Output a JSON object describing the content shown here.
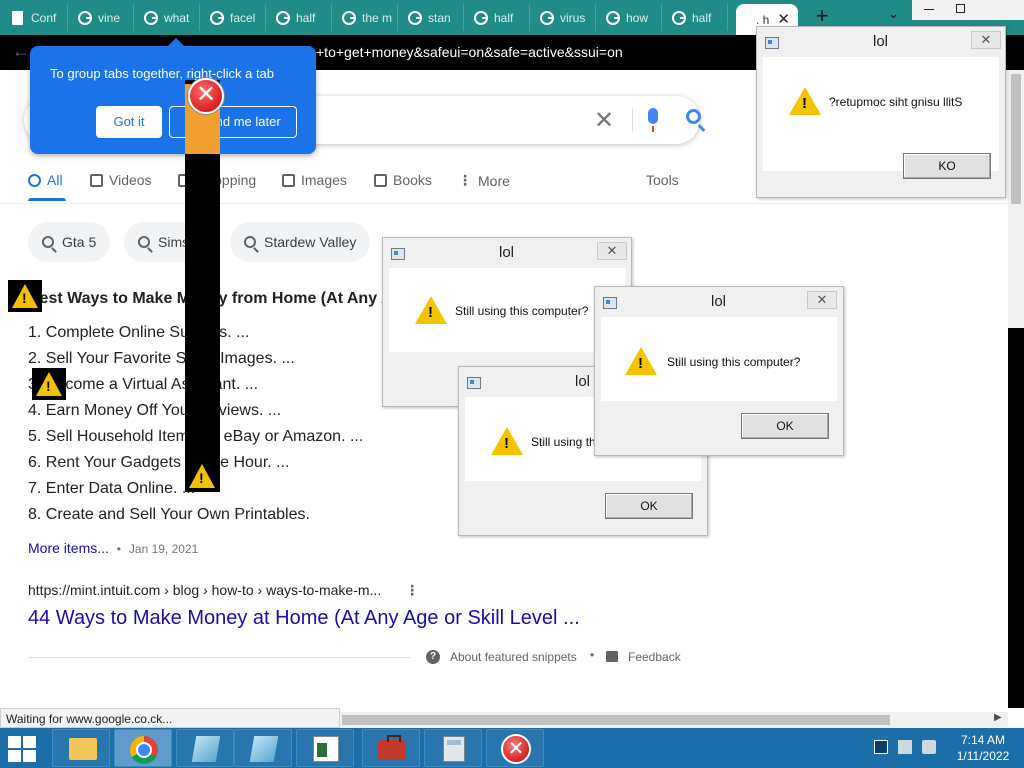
{
  "browser": {
    "tabs": [
      {
        "label": "Conf",
        "icon": "doc-icon"
      },
      {
        "label": "vine",
        "icon": "google-icon"
      },
      {
        "label": "what",
        "icon": "google-icon"
      },
      {
        "label": "facel",
        "icon": "google-icon"
      },
      {
        "label": "half",
        "icon": "google-icon"
      },
      {
        "label": "the m",
        "icon": "google-icon"
      },
      {
        "label": "stan",
        "icon": "google-icon"
      },
      {
        "label": "half",
        "icon": "google-icon"
      },
      {
        "label": "virus",
        "icon": "google-icon"
      },
      {
        "label": "how",
        "icon": "google-icon"
      },
      {
        "label": "half",
        "icon": "google-icon"
      }
    ],
    "active_tab": {
      "label": ". h",
      "close": "✕"
    },
    "new_tab": "+",
    "tab_search": "⌄",
    "url_visible": "+to+get+money&safeui=on&safe=active&ssui=on",
    "back": "←",
    "status_text": "Waiting for www.google.co.ck..."
  },
  "promo": {
    "text": "To group tabs together, right-click a tab",
    "got_it": "Got it",
    "remind_later": "Remind me later"
  },
  "search": {
    "clear": "✕"
  },
  "result_tabs": [
    {
      "label": "All",
      "icon": "search-icon",
      "active": true
    },
    {
      "label": "Videos",
      "icon": "video-icon"
    },
    {
      "label": "Shopping",
      "icon": "tag-icon"
    },
    {
      "label": "Images",
      "icon": "image-icon"
    },
    {
      "label": "Books",
      "icon": "book-icon"
    },
    {
      "label": "More",
      "icon": "more-vert-icon"
    }
  ],
  "tools": "Tools",
  "chips": [
    "Gta 5",
    "Sims 4",
    "Stardew Valley"
  ],
  "snippet": {
    "title": "Best Ways to Make Money from Home (At Any Age",
    "items": [
      "1. Complete Online Surveys. ...",
      "2. Sell Your Favorite Stock Images. ...",
      "3. Become a Virtual Assistant. ...",
      "4. Earn Money Off Your Reviews. ...",
      "5. Sell Household Items on eBay or Amazon. ...",
      "6. Rent Your Gadgets by the Hour. ...",
      "7. Enter Data Online. ...",
      "8. Create and Sell Your Own Printables."
    ],
    "more_items": "More items...",
    "date_sep": "•",
    "date": "Jan 19, 2021"
  },
  "result": {
    "cite": "https://mint.intuit.com › blog › how-to › ways-to-make-m...",
    "menu": "⋮",
    "title": "44 Ways to Make Money at Home (At Any Age or Skill Level ..."
  },
  "about": {
    "q": "?",
    "about_text": "About featured snippets",
    "bullet": "•",
    "feedback": "Feedback"
  },
  "dialogs": [
    {
      "title": "lol",
      "message": "?retupmoc siht gnisu llitS",
      "button": "KO",
      "close": "✕"
    },
    {
      "title": "lol",
      "message": "Still using this computer?",
      "button": "OK",
      "close": "✕"
    },
    {
      "title": "lol",
      "message": "Still using this computer?",
      "button": "OK",
      "close": "✕"
    },
    {
      "title": "lol",
      "message": "Still using this computer?",
      "button": "OK",
      "close": "✕"
    }
  ],
  "overlay": {
    "error_glyph": "✕"
  },
  "taskbar": {
    "time": "7:14 AM",
    "date": "1/11/2022",
    "buttons": [
      "folder-icon",
      "chrome-icon",
      "notepad-icon",
      "notepad-icon",
      "document-icon",
      "toolbox-icon",
      "calculator-icon",
      "error-icon"
    ]
  },
  "colors": {
    "tabstrip": "#1f8c88",
    "promo": "#1a73e8",
    "link": "#1a0dab",
    "taskbar": "#1b6ea8"
  }
}
